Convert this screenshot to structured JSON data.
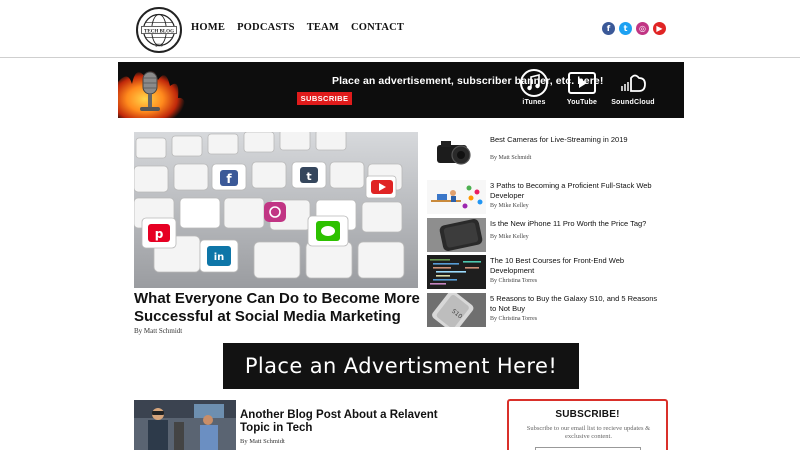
{
  "logo": {
    "alt_text": "THE TECH BLOG 2019"
  },
  "nav": {
    "items": [
      {
        "label": "HOME"
      },
      {
        "label": "PODCASTS"
      },
      {
        "label": "TEAM"
      },
      {
        "label": "CONTACT"
      }
    ]
  },
  "social": {
    "icons": [
      {
        "name": "facebook-icon",
        "glyph": "f",
        "color": "#3b5998"
      },
      {
        "name": "twitter-icon",
        "glyph": "t",
        "color": "#1da1f2"
      },
      {
        "name": "instagram-icon",
        "glyph": "◎",
        "color": "#c13584"
      },
      {
        "name": "youtube-icon",
        "glyph": "▶",
        "color": "#e02424"
      }
    ]
  },
  "banner": {
    "text": "Place an advertisement, subscriber banner, etc. here!",
    "subscribe_label": "SUBSCRIBE",
    "platforms": [
      {
        "label": "iTunes",
        "icon": "music-note-icon"
      },
      {
        "label": "YouTube",
        "icon": "play-icon"
      },
      {
        "label": "SoundCloud",
        "icon": "soundcloud-icon"
      }
    ]
  },
  "featured": {
    "title": "What Everyone Can Do to Become More Successful at Social Media Marketing",
    "author": "By Matt Schmidt"
  },
  "side_posts": [
    {
      "title": "Best Cameras for Live-Streaming in 2019",
      "author": "By Matt Schmidt"
    },
    {
      "title": "3 Paths to Becoming a Proficient Full-Stack Web Developer",
      "author": "By Mike Kelley"
    },
    {
      "title": "Is the New iPhone 11 Pro Worth the Price Tag?",
      "author": "By Mike Kelley"
    },
    {
      "title": "The 10 Best Courses for Front-End Web Development",
      "author": "By Christina Torres"
    },
    {
      "title": "5 Reasons to Buy the Galaxy S10, and 5 Reasons to Not Buy",
      "author": "By Christina Torres"
    }
  ],
  "ad": {
    "text": "Place an Advertisment Here!"
  },
  "bottom_post": {
    "title": "Another Blog Post About a Relavent Topic in Tech",
    "author": "By Matt Schmidt"
  },
  "subscribe_box": {
    "title": "SUBSCRIBE!",
    "description": "Subscribe to our email list to recieve updates & exclusive content."
  },
  "colors": {
    "accent_red": "#e01b1b",
    "banner_bg": "#0d0d0d",
    "border_red": "#d9302a"
  }
}
